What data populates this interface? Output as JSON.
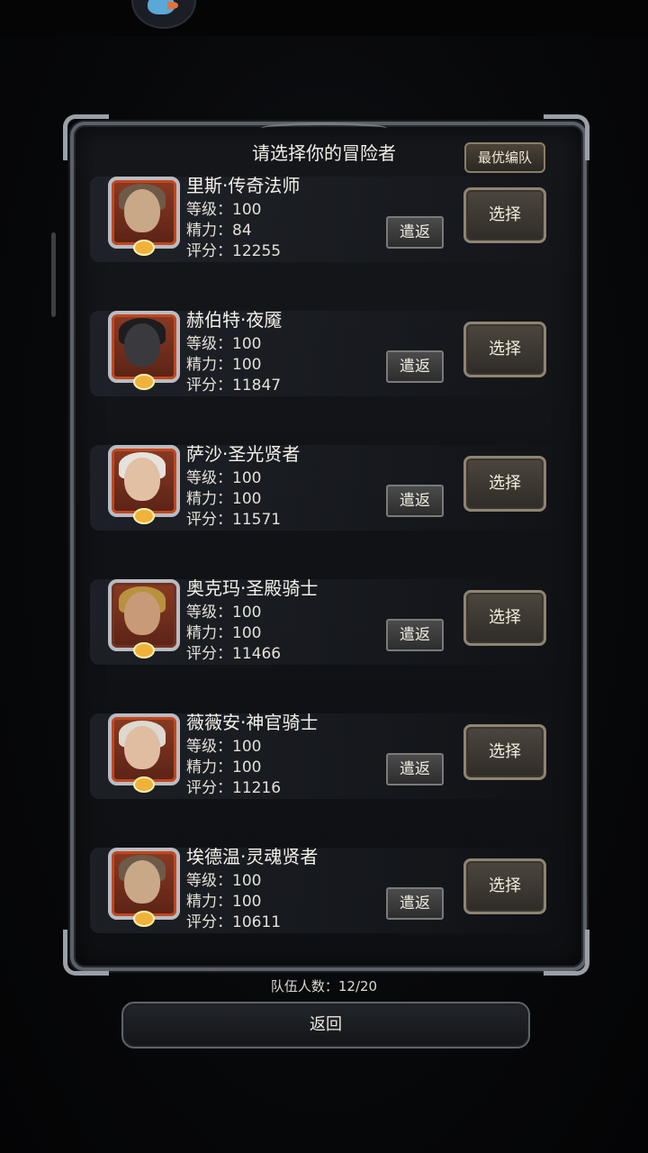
{
  "header": {
    "title": "请选择你的冒险者",
    "best_team_label": "最优编队"
  },
  "heroes": [
    {
      "name": "里斯·传奇法师",
      "level": "等级：100",
      "energy": "精力：84",
      "score": "评分：12255",
      "dismiss": "遣返",
      "select": "选择"
    },
    {
      "name": "赫伯特·夜魇",
      "level": "等级：100",
      "energy": "精力：100",
      "score": "评分：11847",
      "dismiss": "遣返",
      "select": "选择"
    },
    {
      "name": "萨沙·圣光贤者",
      "level": "等级：100",
      "energy": "精力：100",
      "score": "评分：11571",
      "dismiss": "遣返",
      "select": "选择"
    },
    {
      "name": "奥克玛·圣殿骑士",
      "level": "等级：100",
      "energy": "精力：100",
      "score": "评分：11466",
      "dismiss": "遣返",
      "select": "选择"
    },
    {
      "name": "薇薇安·神官骑士",
      "level": "等级：100",
      "energy": "精力：100",
      "score": "评分：11216",
      "dismiss": "遣返",
      "select": "选择"
    },
    {
      "name": "埃德温·灵魂贤者",
      "level": "等级：100",
      "energy": "精力：100",
      "score": "评分：10611",
      "dismiss": "遣返",
      "select": "选择"
    }
  ],
  "footer": {
    "team_count": "队伍人数：12/20",
    "back_label": "返回"
  },
  "icons": {
    "top_avatar": "bird-avatar-icon",
    "portrait_medal": "medal-icon"
  },
  "colors": {
    "background": "#050506",
    "panel_border": "#5c6068",
    "button_border": "#8e8472",
    "portrait_frame": "#c2471f"
  }
}
